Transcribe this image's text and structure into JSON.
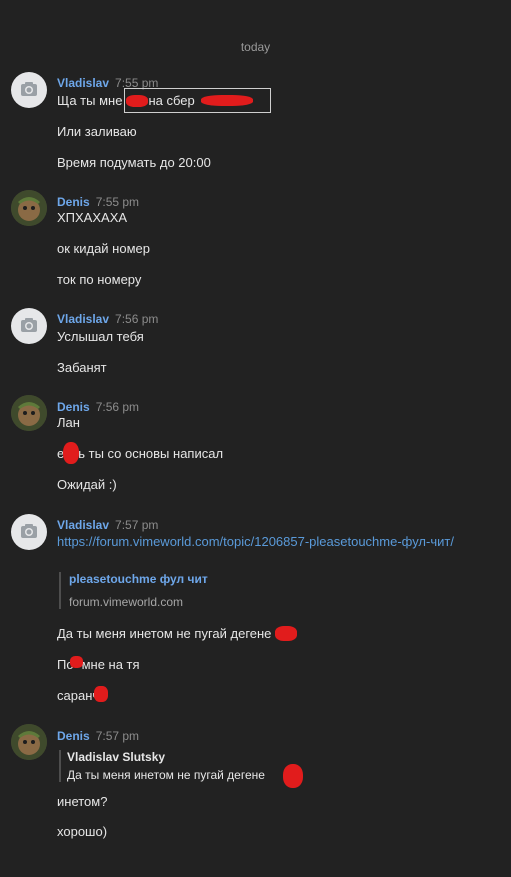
{
  "date_divider": "today",
  "messages": [
    {
      "author": "Vladislav",
      "time": "7:55 pm",
      "avatar": "camera-icon",
      "lines": [
        "Ща ты мне",
        "на сбер",
        "Или заливаю",
        "Время подумать до 20:00"
      ]
    },
    {
      "author": "Denis",
      "time": "7:55 pm",
      "avatar": "user-photo",
      "lines": [
        "ХПХАХАХА",
        "ок кидай номер",
        "ток по номеру"
      ]
    },
    {
      "author": "Vladislav",
      "time": "7:56 pm",
      "avatar": "camera-icon",
      "lines": [
        "Услышал тебя",
        "Забанят"
      ]
    },
    {
      "author": "Denis",
      "time": "7:56 pm",
      "avatar": "user-photo",
      "lines": [
        "Лан",
        "е",
        "ь ты со основы написал",
        "Ожидай :)"
      ]
    },
    {
      "author": "Vladislav",
      "time": "7:57 pm",
      "avatar": "camera-icon",
      "link": "https://forum.vimeworld.com/topic/1206857-pleasetouchme-фул-чит/",
      "embed_title": "pleasetouchme фул чит",
      "embed_site": "forum.vimeworld.com",
      "lines": [
        "Да ты меня инетом не пугай дегене",
        "По",
        "мне на тя",
        "саранч"
      ]
    },
    {
      "author": "Denis",
      "time": "7:57 pm",
      "avatar": "user-photo",
      "quote_author": "Vladislav Slutsky",
      "quote_text": "Да ты меня инетом не пугай дегене",
      "lines": [
        "инетом?",
        "хорошо)"
      ]
    }
  ],
  "colors": {
    "background": "#222222",
    "author": "#6ea7ea",
    "link": "#5a9ad9",
    "redaction": "#e11c1c"
  }
}
